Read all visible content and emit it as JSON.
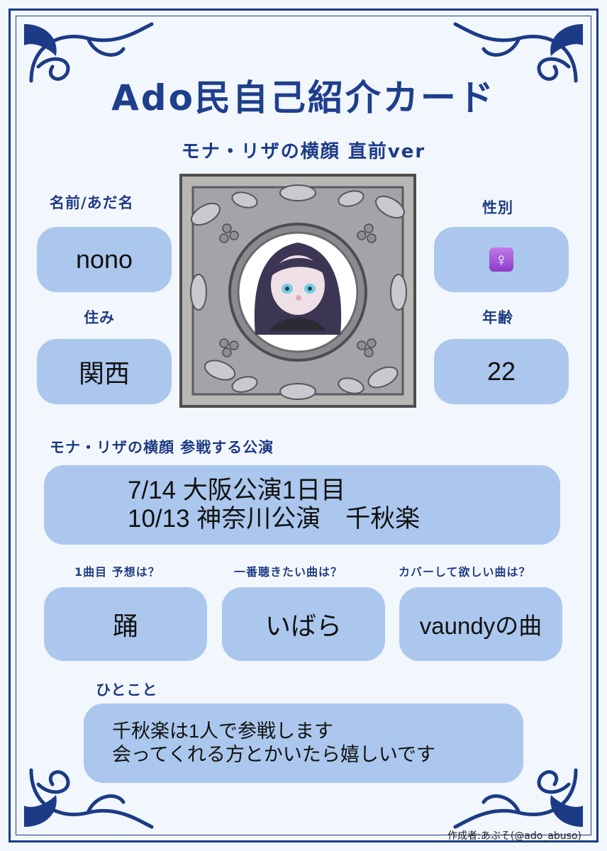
{
  "card": {
    "title": "Ado民自己紹介カード",
    "subtitle": "モナ・リザの横顔 直前ver"
  },
  "fields": {
    "name_label": "名前/あだ名",
    "name_value": "nono",
    "gender_label": "性別",
    "gender_icon": "female-sign-icon",
    "residence_label": "住み",
    "residence_value": "関西",
    "age_label": "年齢",
    "age_value": "22"
  },
  "performances": {
    "label": "モナ・リザの横顔 参戦する公演",
    "lines": [
      "7/14 大阪公演1日目",
      "10/13 神奈川公演　千秋楽"
    ]
  },
  "questions": [
    {
      "label": "1曲目 予想は？",
      "value": "踊"
    },
    {
      "label": "一番聴きたい曲は？",
      "value": "いばら"
    },
    {
      "label": "カバーして欲しい曲は？",
      "value": "vaundyの曲"
    }
  ],
  "comment": {
    "label": "ひとこと",
    "lines": [
      "千秋楽は1人で参戦します",
      "会ってくれる方とかいたら嬉しいです"
    ]
  },
  "credit": "作成者:あぶそ(@ado_abuso)",
  "colors": {
    "accent": "#1c3b86",
    "box": "#abc7ed",
    "background": "#f2f6fd"
  }
}
